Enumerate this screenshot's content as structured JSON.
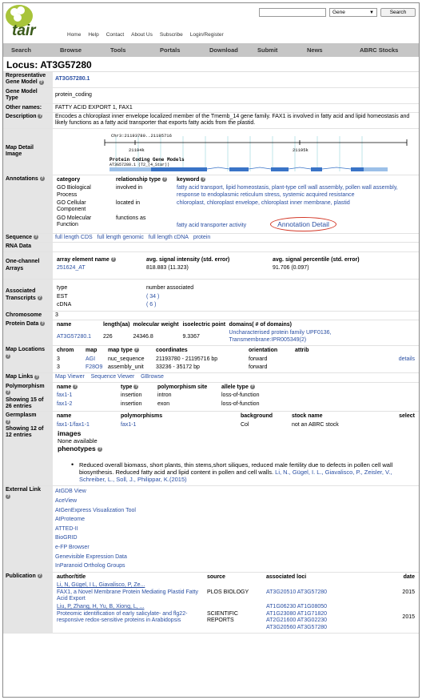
{
  "header": {
    "logo": "tair",
    "nav": [
      "Home",
      "Help",
      "Contact",
      "About Us",
      "Subscribe",
      "Login/Register"
    ],
    "search_value": "",
    "search_select": "Gene",
    "search_button": "Search"
  },
  "mainnav": [
    "Search",
    "Browse",
    "Tools",
    "Portals",
    "Download",
    "Submit",
    "News",
    "ABRC Stocks"
  ],
  "locus_title": "Locus: AT3G57280",
  "rows": {
    "rep_label": "Representative Gene Model",
    "rep_value": "AT3G57280.1",
    "type_label": "Gene Model Type",
    "type_value": "protein_coding",
    "other_label": "Other names:",
    "other_value": "FATTY ACID EXPORT 1, FAX1",
    "desc_label": "Description",
    "desc_value": "Encodes a chloroplast inner envelope localized member of the Tmemb_14 gene family. FAX1 is involved in fatty acid and lipid homeostasis and likely functions as a fatty acid transporter that exports fatty acids from the plastid.",
    "map_label": "Map Detail Image",
    "map_coord": "Chr3:21193780..21195716",
    "map_tick1": "21194k",
    "map_tick2": "21195k",
    "map_models": "Protein Coding Gene Models",
    "map_model_id": "AT3G57280.1 (T2_(4_Star))"
  },
  "annotations": {
    "label": "Annotations",
    "headers": [
      "category",
      "relationship type",
      "keyword"
    ],
    "rows": [
      {
        "cat": "GO Biological Process",
        "rel": "involved in",
        "kw": "fatty acid transport, lipid homeostasis, plant-type cell wall assembly, pollen wall assembly, response to endoplasmic reticulum stress, systemic acquired resistance"
      },
      {
        "cat": "GO Cellular Component",
        "rel": "located in",
        "kw": "chloroplast, chloroplast envelope, chloroplast inner membrane, plastid"
      },
      {
        "cat": "GO Molecular Function",
        "rel": "functions as",
        "kw": "fatty acid transporter activity"
      }
    ],
    "detail": "Annotation Detail"
  },
  "sequence": {
    "label": "Sequence",
    "links": [
      "full length CDS",
      "full length genomic",
      "full length cDNA",
      "protein"
    ]
  },
  "rna": {
    "label": "RNA Data"
  },
  "one_channel": {
    "label": "One-channel Arrays",
    "h1": "array element name",
    "h2": "avg. signal intensity (std. error)",
    "h3": "avg. signal percentile (std. error)",
    "v1": "251624_AT",
    "v2": "818.883 (11.323)",
    "v3": "91.706 (0.097)"
  },
  "assoc": {
    "label": "Associated Transcripts",
    "h1": "type",
    "h2": "number associated",
    "rows": [
      {
        "t": "EST",
        "n": "( 34 )"
      },
      {
        "t": "cDNA",
        "n": "( 6 )"
      }
    ]
  },
  "chromosome": {
    "label": "Chromosome",
    "value": "3"
  },
  "protein": {
    "label": "Protein Data",
    "headers": [
      "name",
      "length(aa)",
      "molecular weight",
      "isoelectric point",
      "domains( # of domains)"
    ],
    "row": {
      "name": "AT3G57280.1",
      "len": "226",
      "mw": "24346.8",
      "pi": "9.3367",
      "dom1": "Uncharacterised protein family UPF0136,",
      "dom2": "Transmembrane:IPR005349(2)"
    }
  },
  "maploc": {
    "label": "Map Locations",
    "headers": [
      "chrom",
      "map",
      "map type",
      "coordinates",
      "orientation",
      "attrib"
    ],
    "rows": [
      {
        "chrom": "3",
        "map": "AGI",
        "type": "nuc_sequence",
        "coord": "21193780 - 21195716 bp",
        "orient": "forward",
        "attrib": "",
        "extra": "details"
      },
      {
        "chrom": "3",
        "map": "F28O9",
        "type": "assembly_unit",
        "coord": "33236 - 35172 bp",
        "orient": "forward",
        "attrib": "",
        "extra": ""
      }
    ]
  },
  "maplinks": {
    "label": "Map Links",
    "links": [
      "Map Viewer",
      "Sequence Viewer",
      "GBrowse"
    ]
  },
  "poly": {
    "label": "Polymorphism",
    "showing": "Showing 15 of 26 entries",
    "headers": [
      "name",
      "type",
      "polymorphism site",
      "allele type"
    ],
    "rows": [
      {
        "name": "fax1-1",
        "type": "insertion",
        "site": "intron",
        "allele": "loss-of-function"
      },
      {
        "name": "fax1-2",
        "type": "insertion",
        "site": "exon",
        "allele": "loss-of-function"
      }
    ]
  },
  "germ": {
    "label": "Germplasm",
    "showing": "Showing 12 of 12 entries",
    "headers": [
      "name",
      "polymorphisms",
      "background",
      "stock name",
      "select"
    ],
    "row": {
      "name": "fax1-1/fax1-1",
      "poly": "fax1-1",
      "bg": "Col",
      "stock": "not an ABRC stock"
    },
    "images": "images",
    "images_none": "None available",
    "phenotypes": "phenotypes",
    "pheno_text": "Reduced overall biomass, short plants, thin stems,short siliques, reduced male fertility due to defects in pollen cell wall biosynthesis. Reduced fatty acid and lipid content in pollen and cell walls.",
    "pheno_ref": "Li, N., Gügel, I. L., Giavalisco, P., Zeisler, V., Schreiber, L., Soll, J., Philippar, K.(2015)"
  },
  "external": {
    "label": "External Link",
    "links": [
      "AtGDB View",
      "AceView",
      "AtGenExpress Visualization Tool",
      "AtProteome",
      "ATTED-II",
      "BioGRID",
      "e-FP Browser",
      "Genevisible Expression Data",
      "InParanoid Ortholog Groups"
    ]
  },
  "pub": {
    "label": "Publication",
    "headers": [
      "author/title",
      "source",
      "associated loci",
      "date"
    ],
    "rows": [
      {
        "authors": "Li, N, Gügel, I L, Giavalisco, P, Ze...",
        "title": "FAX1, a Novel Membrane Protein Mediating Plastid Fatty Acid Export",
        "source": "PLOS BIOLOGY",
        "loci": "AT3G20510  AT3G57280",
        "date": "2015"
      },
      {
        "authors": "Liu, P, Zhang, H, Yu, B, Xiong, L, ...",
        "title": "Proteomic identification of early salicylate- and flg22-responsive redox-sensitive proteins in Arabidopsis",
        "source": "SCIENTIFIC REPORTS",
        "loci": "AT1G06230  AT1G08050  AT1G23080  AT1G71820  AT2G21600  AT3G02230  AT3G20560  AT3G57280",
        "date": "2015"
      }
    ]
  }
}
